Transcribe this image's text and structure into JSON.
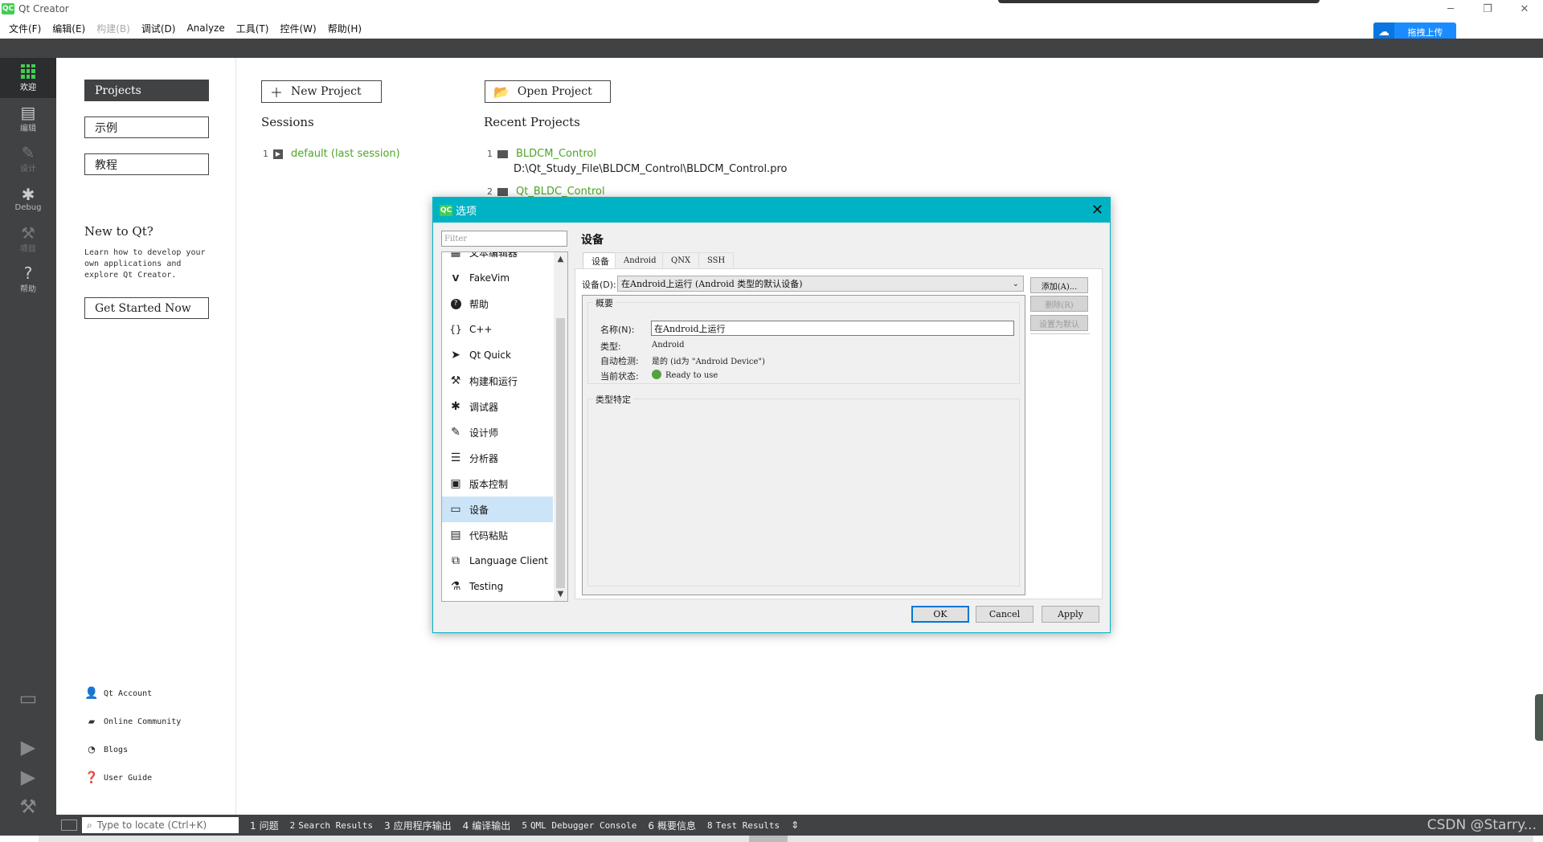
{
  "window": {
    "title": "Qt Creator",
    "logo": "QC"
  },
  "menu": [
    "文件(F)",
    "编辑(E)",
    "构建(B)",
    "调试(D)",
    "Analyze",
    "工具(T)",
    "控件(W)",
    "帮助(H)"
  ],
  "upload_badge": {
    "label": "拖拽上传",
    "icon": "cloud-icon"
  },
  "modes": [
    {
      "label": "欢迎",
      "icon": "grid-icon"
    },
    {
      "label": "编辑",
      "icon": "document-icon"
    },
    {
      "label": "设计",
      "icon": "pencil-icon"
    },
    {
      "label": "Debug",
      "icon": "bug-icon"
    },
    {
      "label": "项目",
      "icon": "wrench-icon"
    },
    {
      "label": "帮助",
      "icon": "help-icon"
    }
  ],
  "welcome": {
    "nav": [
      "Projects",
      "示例",
      "教程"
    ],
    "new_to_qt": "New to Qt?",
    "learn_text": "Learn how to develop your own applications and explore Qt Creator.",
    "get_started": "Get Started Now",
    "links": [
      {
        "label": "Qt Account",
        "icon": "person-icon"
      },
      {
        "label": "Online Community",
        "icon": "chat-icon"
      },
      {
        "label": "Blogs",
        "icon": "rss-icon"
      },
      {
        "label": "User Guide",
        "icon": "help-icon"
      }
    ],
    "new_project": "New Project",
    "open_project": "Open Project",
    "sessions_title": "Sessions",
    "sessions": [
      {
        "num": "1",
        "name": "default (last session)"
      }
    ],
    "recent_title": "Recent Projects",
    "recent": [
      {
        "num": "1",
        "name": "BLDCM_Control",
        "path": "D:\\Qt_Study_File\\BLDCM_Control\\BLDCM_Control.pro"
      },
      {
        "num": "2",
        "name": "Qt_BLDC_Control"
      }
    ]
  },
  "dialog": {
    "title": "选项",
    "logo": "QC",
    "filter_placeholder": "Filter",
    "categories": [
      {
        "label": "文本编辑器",
        "icon": "text-editor-icon"
      },
      {
        "label": "FakeVim",
        "icon": "fakevim-icon"
      },
      {
        "label": "帮助",
        "icon": "help-icon"
      },
      {
        "label": "C++",
        "icon": "braces-icon"
      },
      {
        "label": "Qt Quick",
        "icon": "paper-plane-icon"
      },
      {
        "label": "构建和运行",
        "icon": "hammer-icon"
      },
      {
        "label": "调试器",
        "icon": "bug-icon"
      },
      {
        "label": "设计师",
        "icon": "pencil-icon"
      },
      {
        "label": "分析器",
        "icon": "analyzer-icon"
      },
      {
        "label": "版本控制",
        "icon": "version-control-icon"
      },
      {
        "label": "设备",
        "icon": "device-icon"
      },
      {
        "label": "代码粘贴",
        "icon": "paste-icon"
      },
      {
        "label": "Language Client",
        "icon": "language-client-icon"
      },
      {
        "label": "Testing",
        "icon": "flask-icon"
      }
    ],
    "selected_category": "设备",
    "page_title": "设备",
    "tabs": [
      "设备",
      "Android",
      "QNX",
      "SSH"
    ],
    "device_label": "设备(D):",
    "device_value": "在Android上运行 (Android 类型的默认设备)",
    "add_button": "添加(A)...",
    "remove_button": "删除(R)",
    "set_default_button": "设置为默认",
    "overview": {
      "title": "概要",
      "name_label": "名称(N):",
      "name_value": "在Android上运行",
      "type_label": "类型:",
      "type_value": "Android",
      "autodetect_label": "自动检测:",
      "autodetect_value": "是的 (id为 \"Android Device\")",
      "status_label": "当前状态:",
      "status_value": "Ready to use",
      "status_color": "#52a340"
    },
    "type_specific_title": "类型特定",
    "ok": "OK",
    "cancel": "Cancel",
    "apply": "Apply"
  },
  "statusbar": {
    "locate_placeholder": "Type to locate (Ctrl+K)",
    "tabs": [
      {
        "n": "1",
        "label": "问题"
      },
      {
        "n": "2",
        "label": "Search Results"
      },
      {
        "n": "3",
        "label": "应用程序输出"
      },
      {
        "n": "4",
        "label": "编译输出"
      },
      {
        "n": "5",
        "label": "QML Debugger Console"
      },
      {
        "n": "6",
        "label": "概要信息"
      },
      {
        "n": "8",
        "label": "Test Results"
      }
    ],
    "watermark": "CSDN @Starry..."
  },
  "colors": {
    "accent": "#00b3c4",
    "qt_green": "#41cd52",
    "link_green": "#4ea528",
    "sidebar_dark": "#404244"
  }
}
